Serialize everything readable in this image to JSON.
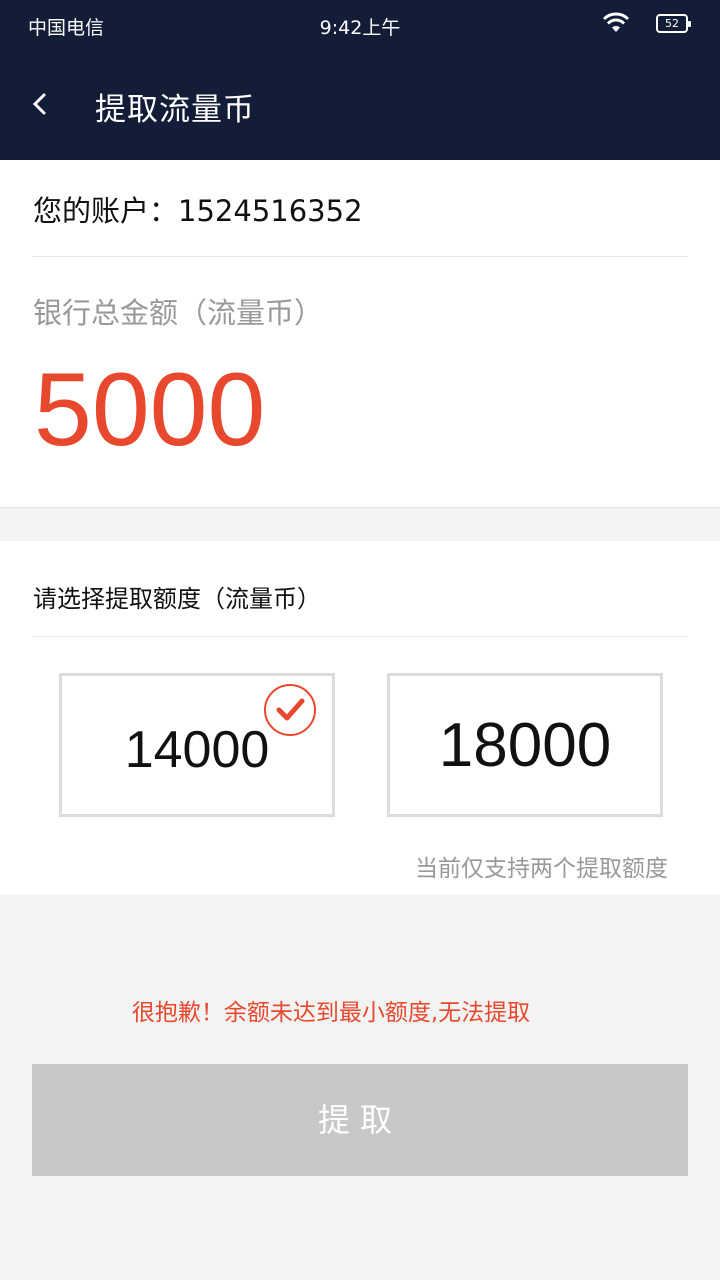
{
  "status_bar": {
    "carrier": "中国电信",
    "time": "9:42上午",
    "battery": "52"
  },
  "header": {
    "title": "提取流量币",
    "back_icon": "chevron-left-icon"
  },
  "account": {
    "label": "您的账户：",
    "number": "1524516352"
  },
  "balance": {
    "label": "银行总金额（流量币）",
    "value": "5000"
  },
  "withdraw": {
    "label": "请选择提取额度（流量币）",
    "options": [
      {
        "amount": "14000",
        "selected": true
      },
      {
        "amount": "18000",
        "selected": false
      }
    ],
    "hint": "当前仅支持两个提取额度"
  },
  "error_message": "很抱歉！余额未达到最小额度,无法提取",
  "submit_label": "提取",
  "colors": {
    "header_bg": "#141d37",
    "accent": "#e8482e",
    "button_disabled": "#c8c8c8"
  }
}
